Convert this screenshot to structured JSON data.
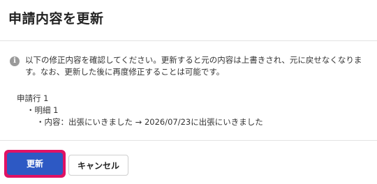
{
  "dialog": {
    "title": "申請内容を更新",
    "notice": {
      "icon": "info-icon",
      "text": "以下の修正内容を確認してください。更新すると元の内容は上書きされ、元に戻せなくなります。なお、更新した後に再度修正することは可能です。"
    },
    "detail": {
      "row_label": "申請行 1",
      "item_label": "・明細 1",
      "change_text": "・内容：出張にいきました → 2026/07/23に出張にいきました"
    },
    "buttons": {
      "save_label": "更新",
      "cancel_label": "キャンセル"
    },
    "colors": {
      "primary": "#2d59c4",
      "focus_ring": "#e01264"
    }
  }
}
